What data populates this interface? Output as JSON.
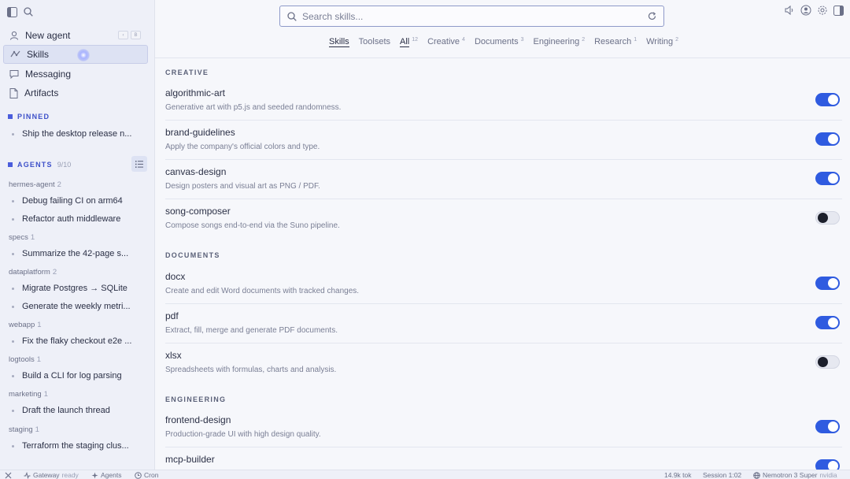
{
  "sidebar": {
    "nav": [
      {
        "label": "New agent",
        "icon": "user-icon"
      },
      {
        "label": "Skills",
        "icon": "skills-icon"
      },
      {
        "label": "Messaging",
        "icon": "chat-icon"
      },
      {
        "label": "Artifacts",
        "icon": "file-icon"
      }
    ],
    "pinned_title": "PINNED",
    "pinned": [
      "Ship the desktop release n..."
    ],
    "agents_title": "AGENTS",
    "agents_count": "9/10",
    "groups": [
      {
        "name": "hermes-agent",
        "count": "2",
        "items": [
          "Debug failing CI on arm64",
          "Refactor auth middleware"
        ]
      },
      {
        "name": "specs",
        "count": "1",
        "items": [
          "Summarize the 42-page s..."
        ]
      },
      {
        "name": "dataplatform",
        "count": "2",
        "items": [
          "Migrate Postgres → SQLite",
          "Generate the weekly metri..."
        ]
      },
      {
        "name": "webapp",
        "count": "1",
        "items": [
          "Fix the flaky checkout e2e ..."
        ]
      },
      {
        "name": "logtools",
        "count": "1",
        "items": [
          "Build a CLI for log parsing"
        ]
      },
      {
        "name": "marketing",
        "count": "1",
        "items": [
          "Draft the launch thread"
        ]
      },
      {
        "name": "staging",
        "count": "1",
        "items": [
          "Terraform the staging clus..."
        ]
      }
    ]
  },
  "search": {
    "placeholder": "Search skills..."
  },
  "tabs": [
    {
      "label": "Skills",
      "count": ""
    },
    {
      "label": "Toolsets",
      "count": ""
    },
    {
      "label": "All",
      "count": "12"
    },
    {
      "label": "Creative",
      "count": "4"
    },
    {
      "label": "Documents",
      "count": "3"
    },
    {
      "label": "Engineering",
      "count": "2"
    },
    {
      "label": "Research",
      "count": "1"
    },
    {
      "label": "Writing",
      "count": "2"
    }
  ],
  "categories": [
    {
      "title": "CREATIVE",
      "skills": [
        {
          "name": "algorithmic-art",
          "desc": "Generative art with p5.js and seeded randomness.",
          "enabled": true
        },
        {
          "name": "brand-guidelines",
          "desc": "Apply the company's official colors and type.",
          "enabled": true
        },
        {
          "name": "canvas-design",
          "desc": "Design posters and visual art as PNG / PDF.",
          "enabled": true
        },
        {
          "name": "song-composer",
          "desc": "Compose songs end-to-end via the Suno pipeline.",
          "enabled": false
        }
      ]
    },
    {
      "title": "DOCUMENTS",
      "skills": [
        {
          "name": "docx",
          "desc": "Create and edit Word documents with tracked changes.",
          "enabled": true
        },
        {
          "name": "pdf",
          "desc": "Extract, fill, merge and generate PDF documents.",
          "enabled": true
        },
        {
          "name": "xlsx",
          "desc": "Spreadsheets with formulas, charts and analysis.",
          "enabled": false
        }
      ]
    },
    {
      "title": "ENGINEERING",
      "skills": [
        {
          "name": "frontend-design",
          "desc": "Production-grade UI with high design quality.",
          "enabled": true
        },
        {
          "name": "mcp-builder",
          "desc": "",
          "enabled": true
        }
      ]
    }
  ],
  "status": {
    "gateway": "Gateway",
    "gateway_state": "ready",
    "agents": "Agents",
    "cron": "Cron",
    "tokens": "14.9k tok",
    "session": "Session 1:02",
    "model": "Nemotron 3 Super",
    "provider": "nvidia"
  },
  "colors": {
    "accent": "#2f5be0",
    "section": "#3d50c9"
  }
}
